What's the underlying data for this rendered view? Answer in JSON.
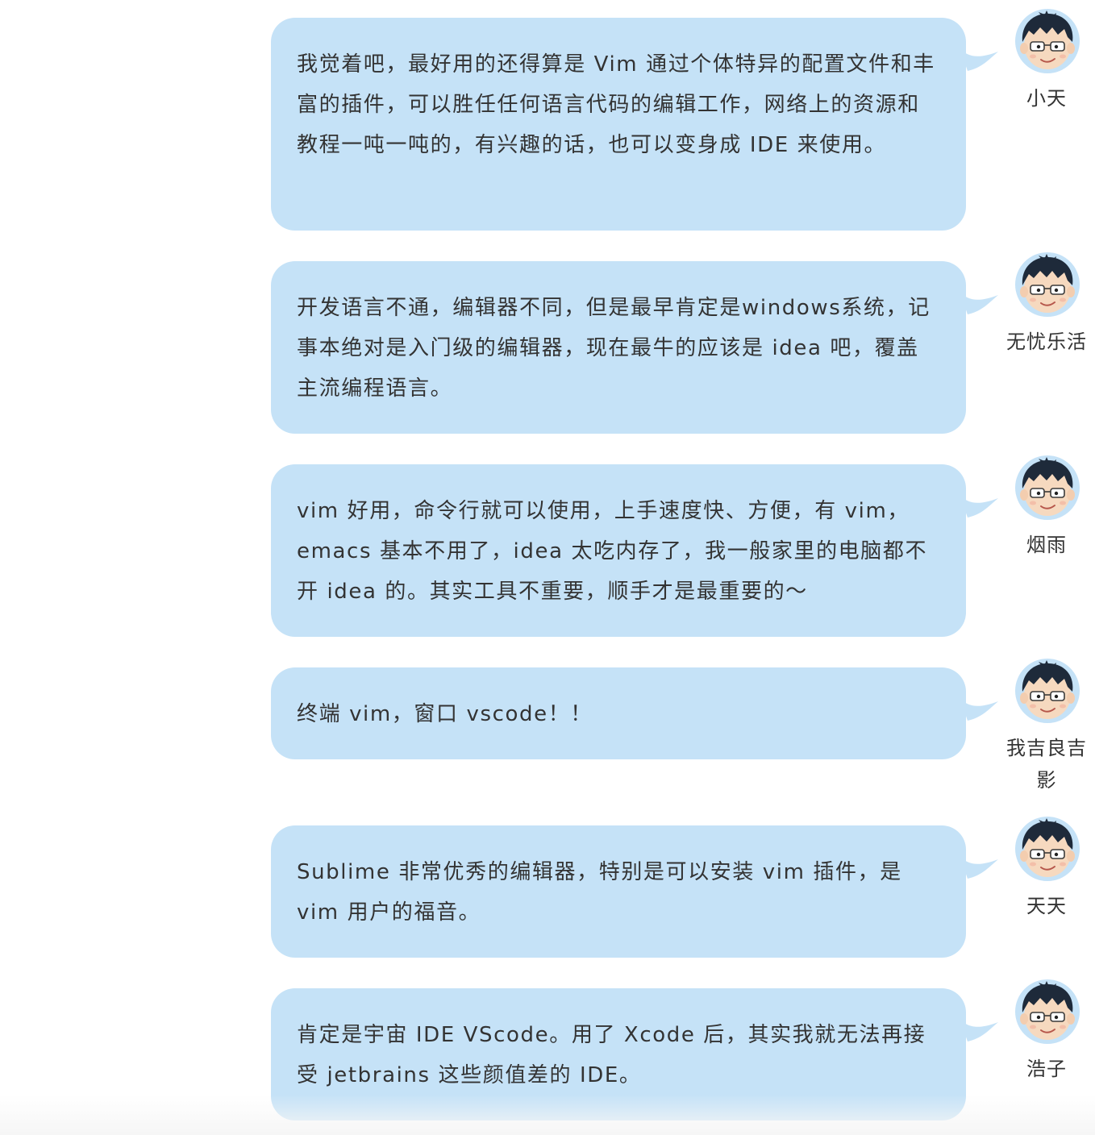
{
  "theme": {
    "bubble_color": "#c5e2f7",
    "text_color": "#333333"
  },
  "messages": [
    {
      "name": "小天",
      "text": "我觉着吧，最好用的还得算是 Vim 通过个体特异的配置文件和丰富的插件，可以胜任任何语言代码的编辑工作，网络上的资源和教程一吨一吨的，有兴趣的话，也可以变身成 IDE 来使用。"
    },
    {
      "name": "无忧乐活",
      "text": "开发语言不通，编辑器不同，但是最早肯定是windows系统，记事本绝对是入门级的编辑器，现在最牛的应该是 idea 吧，覆盖主流编程语言。"
    },
    {
      "name": "烟雨",
      "text": "vim 好用，命令行就可以使用，上手速度快、方便，有 vim，emacs 基本不用了，idea 太吃内存了，我一般家里的电脑都不开 idea 的。其实工具不重要，顺手才是最重要的～"
    },
    {
      "name": "我吉良吉影",
      "text": "终端 vim，窗口 vscode！！"
    },
    {
      "name": "天天",
      "text": "Sublime 非常优秀的编辑器，特别是可以安装 vim 插件，是 vim 用户的福音。"
    },
    {
      "name": "浩子",
      "text": "肯定是宇宙 IDE VScode。用了 Xcode 后，其实我就无法再接受 jetbrains  这些颜值差的 IDE。"
    }
  ]
}
